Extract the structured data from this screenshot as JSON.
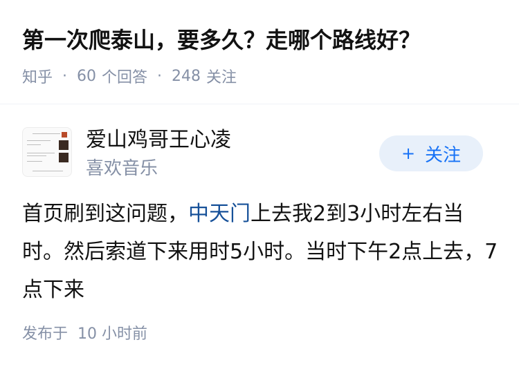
{
  "question": {
    "title": "第一次爬泰山，要多久？走哪个路线好？",
    "source": "知乎",
    "answers_count": "60",
    "answers_label": "个回答",
    "followers_count": "248",
    "followers_label": "关注",
    "separator": "·"
  },
  "answer": {
    "author": {
      "name": "爱山鸡哥王心凌",
      "bio": "喜欢音乐",
      "avatar_icon": "avatar-image"
    },
    "follow_button": {
      "icon": "+",
      "label": "关注"
    },
    "content": {
      "part1": "首页刷到这问题，",
      "link_text": "中天门",
      "part2": "上去我2到3小时左右当时。然后索道下来用时5小时。当时下午2点上去，7点下来"
    },
    "published_label": "发布于",
    "published_time": "10 小时前"
  },
  "colors": {
    "accent": "#1772f6",
    "link": "#175199",
    "meta_text": "#8590a6",
    "follow_bg": "#e8f0fa"
  }
}
